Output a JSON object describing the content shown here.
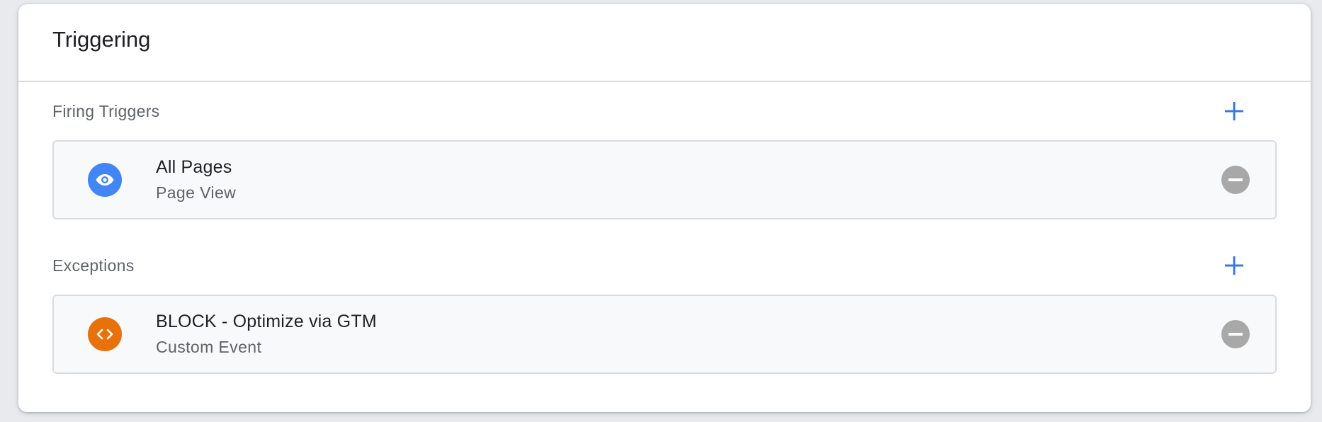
{
  "card": {
    "title": "Triggering"
  },
  "colors": {
    "accent": "#4285f4",
    "plus": "#3b78e7",
    "page_view_icon_bg": "#4285f4",
    "custom_event_icon_bg": "#e8710a",
    "remove_bg": "#a8a8a8"
  },
  "firing": {
    "label": "Firing Triggers",
    "add_icon": "plus-icon",
    "items": [
      {
        "title": "All Pages",
        "type": "Page View",
        "icon": "eye-icon"
      }
    ]
  },
  "exceptions": {
    "label": "Exceptions",
    "add_icon": "plus-icon",
    "items": [
      {
        "title": "BLOCK - Optimize via GTM",
        "type": "Custom Event",
        "icon": "code-icon"
      }
    ]
  }
}
